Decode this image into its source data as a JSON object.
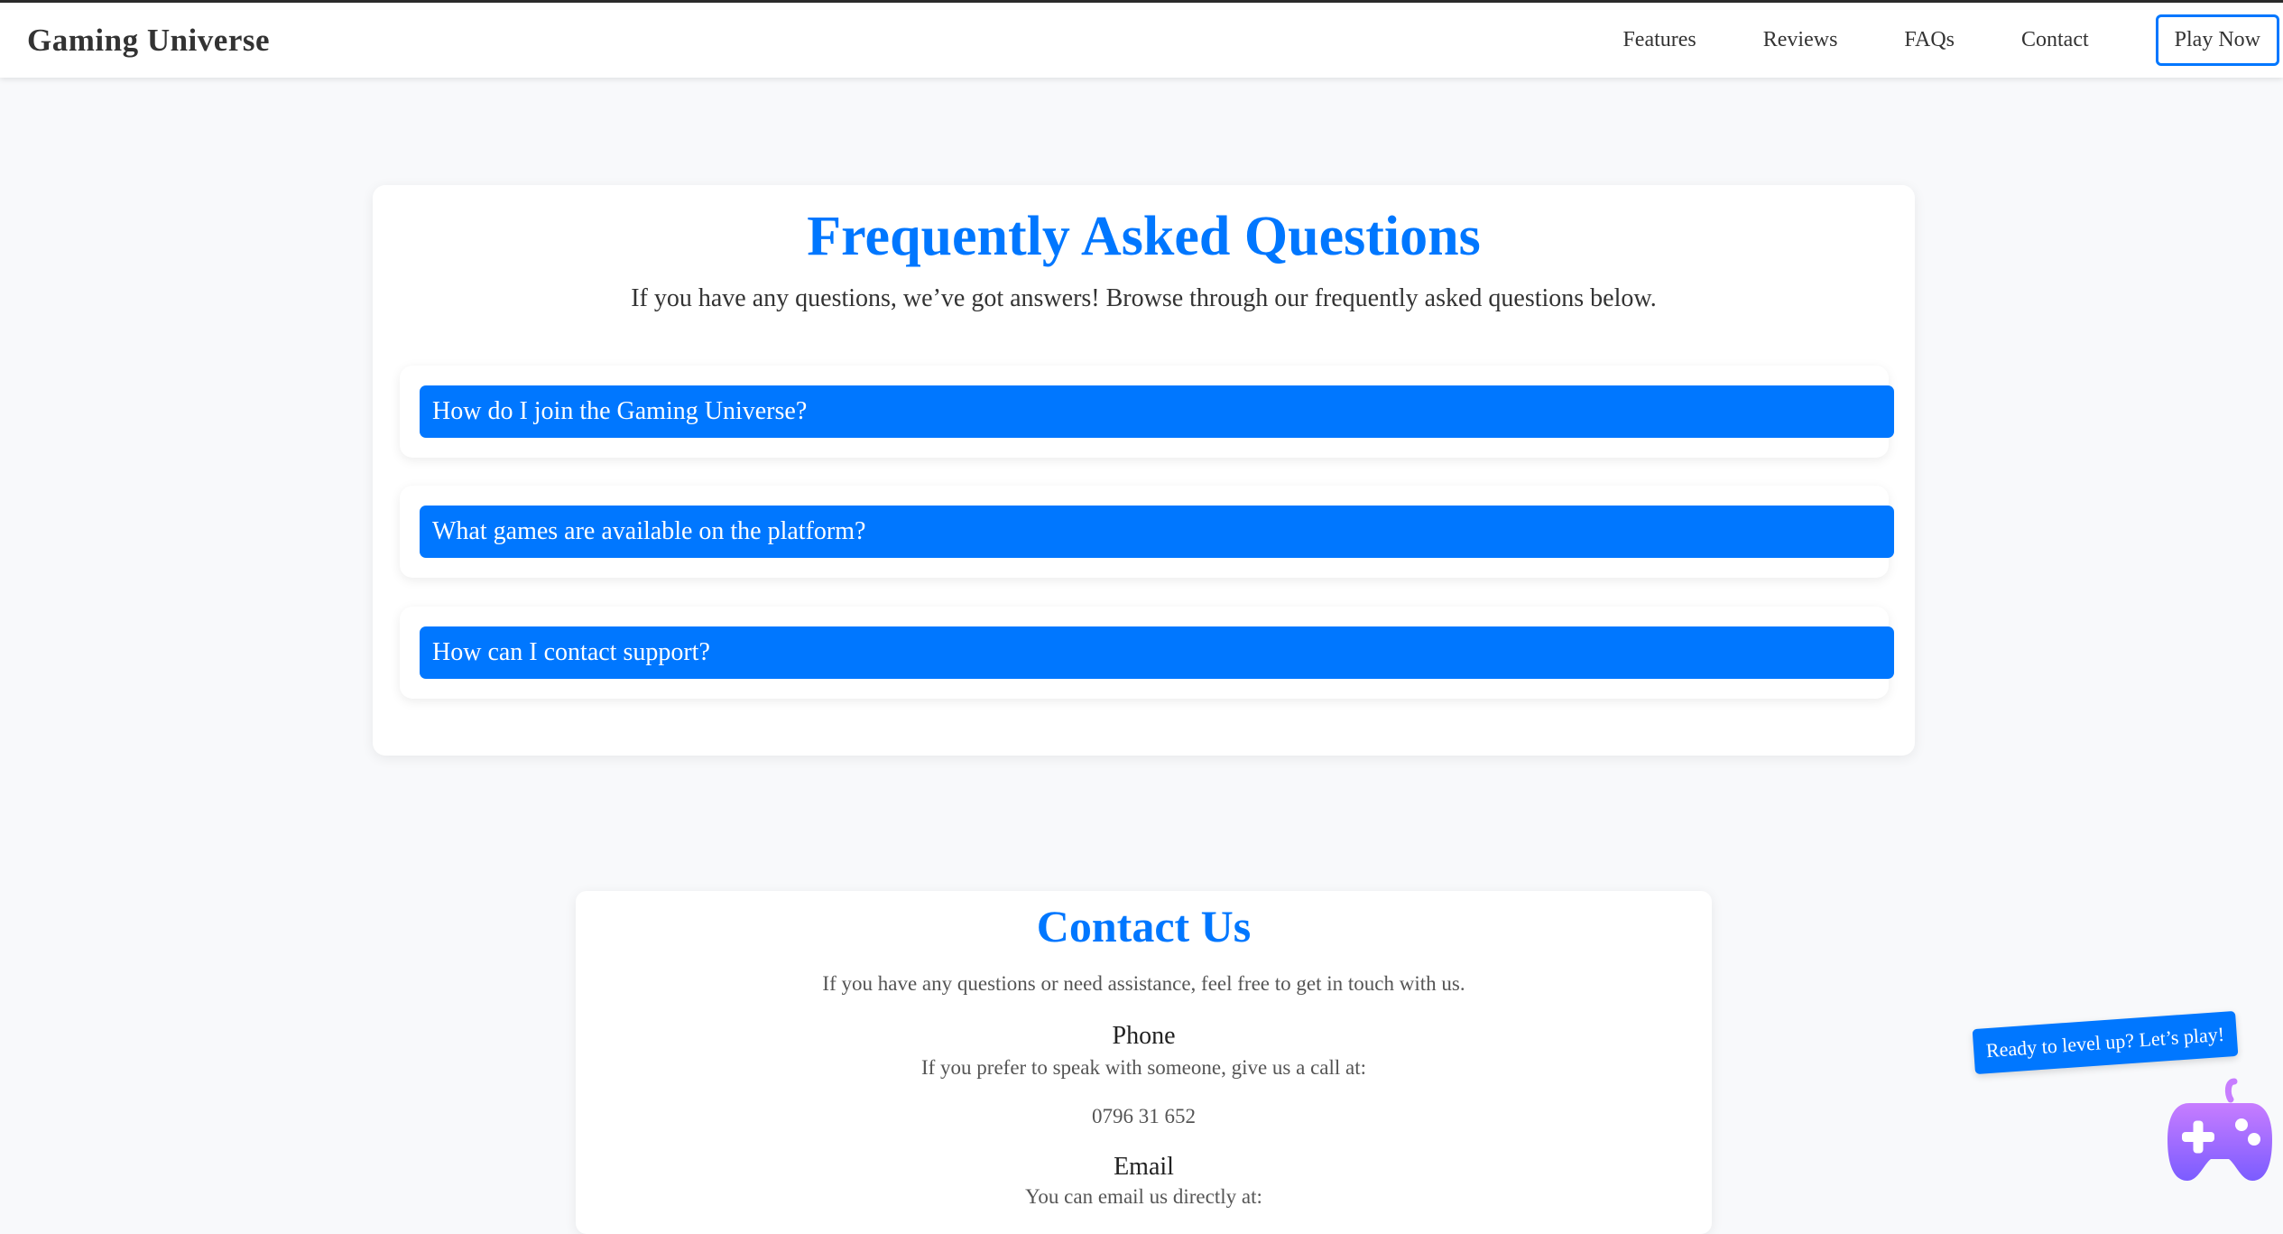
{
  "nav": {
    "brand": "Gaming Universe",
    "links": [
      "Features",
      "Reviews",
      "FAQs",
      "Contact"
    ],
    "cta": "Play Now"
  },
  "faq": {
    "title": "Frequently Asked Questions",
    "subtitle": "If you have any questions, we’ve got answers! Browse through our frequently asked questions below.",
    "items": [
      "How do I join the Gaming Universe?",
      "What games are available on the platform?",
      "How can I contact support?"
    ]
  },
  "contact": {
    "title": "Contact Us",
    "subtitle": "If you have any questions or need assistance, feel free to get in touch with us.",
    "phone_heading": "Phone",
    "phone_text": "If you prefer to speak with someone, give us a call at:",
    "phone_number": "0796 31 652",
    "email_heading": "Email",
    "email_text": "You can email us directly at:"
  },
  "promo": {
    "bubble": "Ready to level up? Let’s play!",
    "icon": "gamepad-icon"
  },
  "colors": {
    "accent": "#0077ff",
    "background": "#f8f9fb",
    "gamepad_top": "#c77dff",
    "gamepad_bottom": "#7b5cff"
  }
}
